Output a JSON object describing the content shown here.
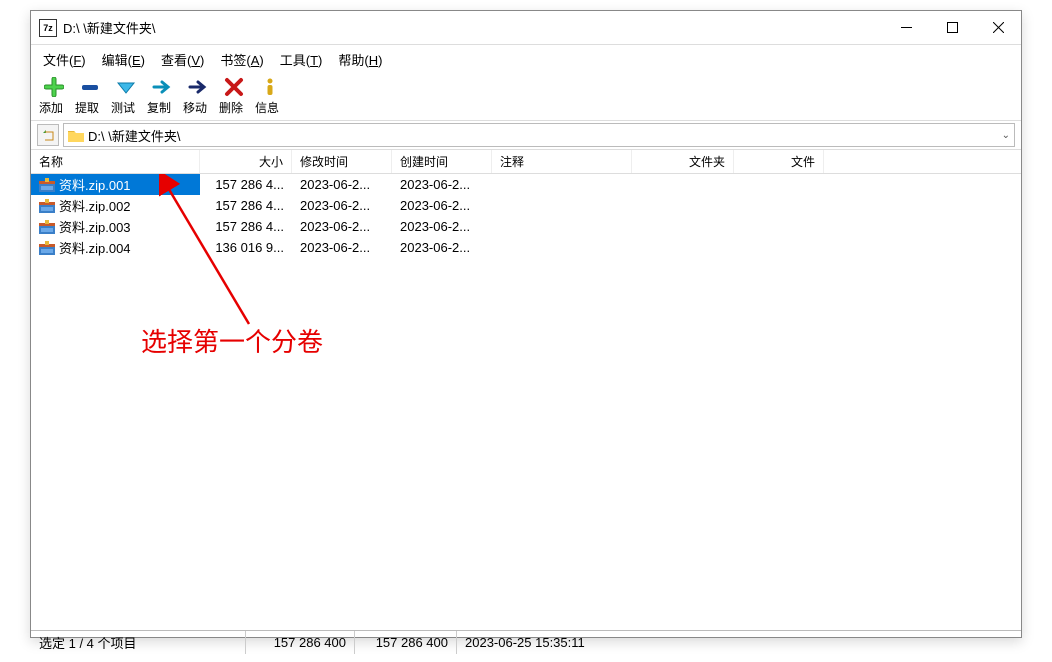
{
  "title": "D:\\        \\新建文件夹\\",
  "menu": {
    "file": "文件(F)",
    "edit": "编辑(E)",
    "view": "查看(V)",
    "bookmarks": "书签(A)",
    "tools": "工具(T)",
    "help": "帮助(H)"
  },
  "toolbar": {
    "add": "添加",
    "extract": "提取",
    "test": "测试",
    "copy": "复制",
    "move": "移动",
    "delete": "删除",
    "info": "信息"
  },
  "path": "D:\\          \\新建文件夹\\",
  "columns": {
    "name": "名称",
    "size": "大小",
    "mtime": "修改时间",
    "ctime": "创建时间",
    "comment": "注释",
    "folders": "文件夹",
    "files": "文件"
  },
  "rows": [
    {
      "name": "资料.zip.001",
      "size": "157 286 4...",
      "mtime": "2023-06-2...",
      "ctime": "2023-06-2...",
      "selected": true
    },
    {
      "name": "资料.zip.002",
      "size": "157 286 4...",
      "mtime": "2023-06-2...",
      "ctime": "2023-06-2...",
      "selected": false
    },
    {
      "name": "资料.zip.003",
      "size": "157 286 4...",
      "mtime": "2023-06-2...",
      "ctime": "2023-06-2...",
      "selected": false
    },
    {
      "name": "资料.zip.004",
      "size": "136 016 9...",
      "mtime": "2023-06-2...",
      "ctime": "2023-06-2...",
      "selected": false
    }
  ],
  "annotation": "选择第一个分卷",
  "status": {
    "sel": "选定 1 / 4 个项目",
    "s1": "157 286 400",
    "s2": "157 286 400",
    "date": "2023-06-25 15:35:11"
  }
}
